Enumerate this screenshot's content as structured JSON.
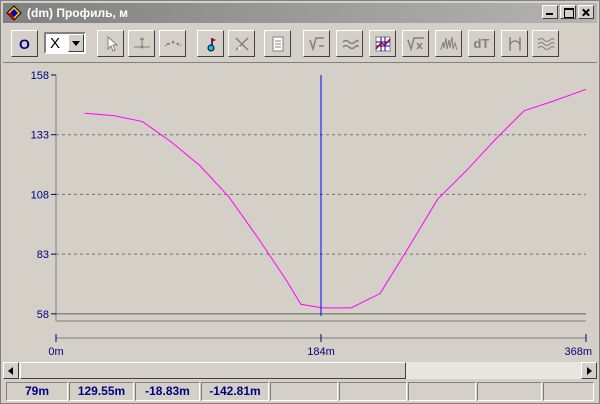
{
  "window": {
    "title": "(dm) Профиль, м",
    "colors": {
      "title_gradient_start": "#808080",
      "title_text": "#ffffff"
    }
  },
  "toolbar": {
    "o_label": "O",
    "axis_selector": {
      "value": "X"
    },
    "icons": [
      "cursor-icon",
      "baseline-icon",
      "dotted-line-icon",
      "marker-pin-icon",
      "crosshair-icon",
      "document-icon",
      "v-minus-icon",
      "wave-filter-icon",
      "grid-chart-icon",
      "v-x-icon",
      "spectrum-icon",
      "dt-icon",
      "bracket-icon",
      "multi-wave-icon"
    ],
    "dt_label": "dT"
  },
  "chart_data": {
    "type": "line",
    "title": "",
    "xlabel": "",
    "ylabel": "",
    "ylim": [
      55,
      158
    ],
    "xlim": [
      0,
      368
    ],
    "y_ticks": [
      58,
      83,
      108,
      133,
      158
    ],
    "x_ticks": [
      {
        "value": 0,
        "label": "0m"
      },
      {
        "value": 184,
        "label": "184m"
      },
      {
        "value": 368,
        "label": "368m"
      }
    ],
    "grid": "horizontal-dashed",
    "series": [
      {
        "color": "#ff00ff",
        "x": [
          20,
          40,
          60,
          80,
          100,
          120,
          140,
          160,
          170,
          185,
          205,
          225,
          245,
          265,
          285,
          305,
          325,
          345,
          368
        ],
        "y": [
          142,
          141,
          138.5,
          130,
          120,
          107,
          90,
          72,
          62,
          60.5,
          60.5,
          66.5,
          86,
          106,
          118,
          131,
          143,
          147,
          152
        ]
      }
    ],
    "cursor": {
      "x": 184,
      "color": "#0000ff"
    },
    "colors": {
      "plot_background": "#d4d0c8",
      "tick_label": "#000080"
    }
  },
  "status": {
    "cells": [
      "79m",
      "129.55m",
      "-18.83m",
      "-142.81m",
      "",
      "",
      "",
      "",
      ""
    ]
  }
}
